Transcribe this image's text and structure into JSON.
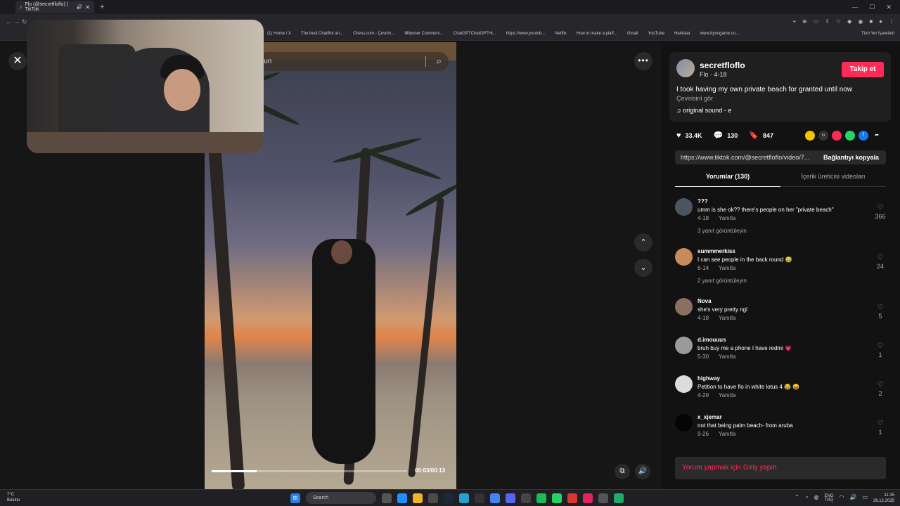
{
  "browser": {
    "tab_title": "Flo (@secretfloflo) | TikTok",
    "bookmarks": [
      "(1) Home / X",
      "The best ChatBot an...",
      "Chess.com - Çevrim...",
      "Milyoner Commerc...",
      "ChatGPTChatGPTHt...",
      "https://www.youtub...",
      "Netflix",
      "How to make a platf...",
      "Gmail",
      "YouTube",
      "Haritalar",
      "www.bynogame.co..."
    ],
    "all_bookmarks": "Tüm Yer İşaretleri"
  },
  "player": {
    "search_placeholder": "lun",
    "time": "00:03/00:13",
    "progress": 0.23
  },
  "post": {
    "username": "secretfloflo",
    "sub": "Flo · 4-18",
    "follow_label": "Takip et",
    "description": "I took having my own private beach for granted until now",
    "translate": "Çevirisini gör",
    "sound": "original sound - e",
    "likes": "33.4K",
    "comments": "130",
    "saves": "847",
    "link": "https://www.tiktok.com/@secretfloflo/video/7...",
    "copy_label": "Bağlantıyı kopyala",
    "tab_comments": "Yorumlar (130)",
    "tab_creator": "İçerik üreticisi videoları"
  },
  "comments": [
    {
      "name": "???",
      "text": "umm is she ok?? there's people on her \"private beach\"",
      "date": "4-18",
      "reply": "Yanıtla",
      "likes": "366",
      "more": "3 yanıt görüntüleyin",
      "color": "#4a5560"
    },
    {
      "name": "summmerkiss",
      "text": "I can see people in the back round 😅",
      "date": "6-14",
      "reply": "Yanıtla",
      "likes": "24",
      "more": "2 yanıt görüntüleyin",
      "color": "#c78a5a"
    },
    {
      "name": "Nova",
      "text": "she's very pretty ngl",
      "date": "4-18",
      "reply": "Yanıtla",
      "likes": "5",
      "more": "",
      "color": "#8a7060"
    },
    {
      "name": "d.imouuus",
      "text": "bruh buy me a phone I have redmi 💗",
      "date": "5-30",
      "reply": "Yanıtla",
      "likes": "1",
      "more": "",
      "color": "#9a9a9a"
    },
    {
      "name": "highway",
      "text": "Petition to have flo in white lotus 4 😂 😝",
      "date": "4-29",
      "reply": "Yanıtla",
      "likes": "2",
      "more": "",
      "color": "#dcdcdc"
    },
    {
      "name": "x_xjemar",
      "text": "not that being palm beach- from aruba",
      "date": "9-26",
      "reply": "Yanıtla",
      "likes": "1",
      "more": "",
      "color": "#050505"
    }
  ],
  "login_prompt": "Yorum yapmak için Giriş yapın",
  "taskbar": {
    "weather_temp": "7°C",
    "weather_desc": "Bulutlu",
    "search": "Search",
    "lang1": "ENG",
    "lang2": "TRQ",
    "time": "11:15",
    "date": "26.12.2025"
  }
}
